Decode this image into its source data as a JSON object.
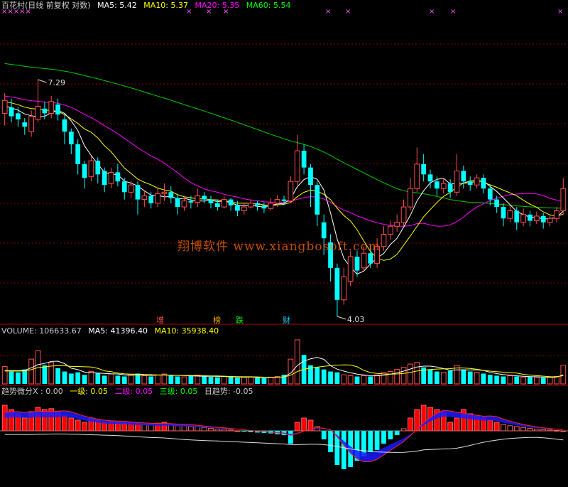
{
  "colors": {
    "up": "#ff5050",
    "down": "#00ffff",
    "ma5": "#ffffff",
    "ma10": "#ffff00",
    "ma20": "#ff00ff",
    "ma60": "#00cc00",
    "grid": "#8a0000",
    "label": "#cccccc"
  },
  "price_header": {
    "name": "百花村(日线 前复权 对数)",
    "ma5_label": "MA5: 5.42",
    "ma10_label": "MA10: 5.37",
    "ma20_label": "MA20: 5.35",
    "ma60_label": "MA60: 5.54"
  },
  "volume_header": {
    "vol_label": "VOLUME: 106633.67",
    "ma5_label": "MA5: 41396.40",
    "ma10_label": "MA10: 35938.40"
  },
  "indicator_header": {
    "name_label": "趋势微分X : 0.00",
    "l1_label": "一级: 0.05",
    "l2_label": "二级: 0.05",
    "l3_label": "三级: 0.05",
    "trend_label": "日趋势: -0.05"
  },
  "watermark": "翔博软件 www.xiangbosoft.com",
  "top_markers": [
    "×××××",
    "×",
    "×",
    "×",
    "×",
    "×",
    "×",
    "×",
    "×"
  ],
  "signals": [
    {
      "text": "增",
      "color": "#ff5050"
    },
    {
      "text": "榜",
      "color": "#ffaa00"
    },
    {
      "text": "跌",
      "color": "#00ff00"
    },
    {
      "text": "财",
      "color": "#00ccff"
    }
  ],
  "annotations": {
    "high": "7.29",
    "low": "4.03"
  },
  "chart_data": {
    "type": "candlestick",
    "candles": [
      [
        6.7,
        6.92,
        6.5,
        7.05
      ],
      [
        6.8,
        6.65,
        6.55,
        6.95
      ],
      [
        6.7,
        6.6,
        6.48,
        6.8
      ],
      [
        6.55,
        6.48,
        6.35,
        6.62
      ],
      [
        6.4,
        6.65,
        6.32,
        6.75
      ],
      [
        6.6,
        6.82,
        6.55,
        7.29
      ],
      [
        6.78,
        6.7,
        6.6,
        6.9
      ],
      [
        6.7,
        6.9,
        6.62,
        7.0
      ],
      [
        6.85,
        6.68,
        6.58,
        6.95
      ],
      [
        6.6,
        6.4,
        6.2,
        6.68
      ],
      [
        6.4,
        6.2,
        6.05,
        6.45
      ],
      [
        6.2,
        5.9,
        5.75,
        6.28
      ],
      [
        5.9,
        5.7,
        5.55,
        5.95
      ],
      [
        5.72,
        5.95,
        5.65,
        6.02
      ],
      [
        5.95,
        5.75,
        5.62,
        6.0
      ],
      [
        5.8,
        5.6,
        5.5,
        5.85
      ],
      [
        5.62,
        5.78,
        5.55,
        5.85
      ],
      [
        5.78,
        5.65,
        5.58,
        5.9
      ],
      [
        5.65,
        5.5,
        5.4,
        5.7
      ],
      [
        5.5,
        5.6,
        5.42,
        5.65
      ],
      [
        5.6,
        5.4,
        5.2,
        5.65
      ],
      [
        5.4,
        5.45,
        5.3,
        5.52
      ],
      [
        5.45,
        5.35,
        5.28,
        5.5
      ],
      [
        5.35,
        5.48,
        5.3,
        5.55
      ],
      [
        5.48,
        5.5,
        5.38,
        5.62
      ],
      [
        5.5,
        5.42,
        5.35,
        5.58
      ],
      [
        5.42,
        5.3,
        5.2,
        5.48
      ],
      [
        5.3,
        5.38,
        5.25,
        5.45
      ],
      [
        5.38,
        5.36,
        5.28,
        5.45
      ],
      [
        5.36,
        5.45,
        5.3,
        5.55
      ],
      [
        5.45,
        5.4,
        5.35,
        5.5
      ],
      [
        5.4,
        5.35,
        5.28,
        5.45
      ],
      [
        5.35,
        5.3,
        5.25,
        5.4
      ],
      [
        5.3,
        5.4,
        5.28,
        5.44
      ],
      [
        5.4,
        5.32,
        5.25,
        5.42
      ],
      [
        5.32,
        5.25,
        5.18,
        5.38
      ],
      [
        5.25,
        5.3,
        5.2,
        5.35
      ],
      [
        5.3,
        5.35,
        5.28,
        5.4
      ],
      [
        5.35,
        5.32,
        5.25,
        5.38
      ],
      [
        5.32,
        5.28,
        5.22,
        5.36
      ],
      [
        5.28,
        5.35,
        5.25,
        5.42
      ],
      [
        5.35,
        5.4,
        5.3,
        5.46
      ],
      [
        5.4,
        5.38,
        5.32,
        5.45
      ],
      [
        5.38,
        5.65,
        5.35,
        5.72
      ],
      [
        5.65,
        6.1,
        5.6,
        6.35
      ],
      [
        6.1,
        5.85,
        5.75,
        6.2
      ],
      [
        5.85,
        5.6,
        5.3,
        5.9
      ],
      [
        5.6,
        5.2,
        5.05,
        5.65
      ],
      [
        5.1,
        4.9,
        4.7,
        5.2
      ],
      [
        4.85,
        4.55,
        4.4,
        4.95
      ],
      [
        4.55,
        4.2,
        4.03,
        4.6
      ],
      [
        4.2,
        4.45,
        4.15,
        4.55
      ],
      [
        4.4,
        4.68,
        4.35,
        4.75
      ],
      [
        4.68,
        4.52,
        4.45,
        4.75
      ],
      [
        4.55,
        4.72,
        4.5,
        4.8
      ],
      [
        4.72,
        4.6,
        4.55,
        4.82
      ],
      [
        4.6,
        4.8,
        4.55,
        4.9
      ],
      [
        4.8,
        4.95,
        4.75,
        5.05
      ],
      [
        4.95,
        5.05,
        4.88,
        5.12
      ],
      [
        5.05,
        5.1,
        4.98,
        5.2
      ],
      [
        5.1,
        5.3,
        5.05,
        5.4
      ],
      [
        5.3,
        5.55,
        5.25,
        5.7
      ],
      [
        5.55,
        5.9,
        5.5,
        6.15
      ],
      [
        5.9,
        5.75,
        5.65,
        6.05
      ],
      [
        5.75,
        5.65,
        5.55,
        5.82
      ],
      [
        5.65,
        5.55,
        5.45,
        5.72
      ],
      [
        5.55,
        5.62,
        5.48,
        5.7
      ],
      [
        5.62,
        5.5,
        5.42,
        5.68
      ],
      [
        5.5,
        5.8,
        5.45,
        6.05
      ],
      [
        5.8,
        5.65,
        5.55,
        5.88
      ],
      [
        5.65,
        5.6,
        5.52,
        5.72
      ],
      [
        5.6,
        5.7,
        5.55,
        5.75
      ],
      [
        5.7,
        5.55,
        5.48,
        5.75
      ],
      [
        5.55,
        5.4,
        5.32,
        5.6
      ],
      [
        5.4,
        5.3,
        5.22,
        5.45
      ],
      [
        5.3,
        5.15,
        5.05,
        5.35
      ],
      [
        5.15,
        5.25,
        5.1,
        5.32
      ],
      [
        5.25,
        5.1,
        5.0,
        5.3
      ],
      [
        5.1,
        5.2,
        5.05,
        5.28
      ],
      [
        5.2,
        5.12,
        5.05,
        5.25
      ],
      [
        5.12,
        5.18,
        5.08,
        5.24
      ],
      [
        5.18,
        5.1,
        5.02,
        5.22
      ],
      [
        5.1,
        5.15,
        5.05,
        5.2
      ],
      [
        5.15,
        5.25,
        5.1,
        5.3
      ],
      [
        5.25,
        5.55,
        5.2,
        5.7
      ]
    ],
    "volume": [
      42000,
      30000,
      28000,
      35000,
      60000,
      80000,
      45000,
      52000,
      38000,
      30000,
      25000,
      28000,
      22000,
      30000,
      26000,
      20000,
      24000,
      20000,
      18000,
      22000,
      25000,
      20000,
      18000,
      22000,
      24000,
      20000,
      18000,
      17000,
      19000,
      21000,
      18000,
      17000,
      16000,
      18000,
      17000,
      15000,
      16000,
      17000,
      15000,
      14000,
      16000,
      18000,
      22000,
      60000,
      106633,
      70000,
      45000,
      40000,
      35000,
      30000,
      28000,
      22000,
      20000,
      18000,
      20000,
      18000,
      22000,
      28000,
      30000,
      35000,
      40000,
      48000,
      52000,
      40000,
      35000,
      30000,
      28000,
      32000,
      45000,
      35000,
      30000,
      28000,
      25000,
      22000,
      20000,
      18000,
      20000,
      18000,
      16000,
      17000,
      16000,
      15000,
      16000,
      18000,
      45000
    ],
    "indicator": [
      0.6,
      0.5,
      0.4,
      0.3,
      0.45,
      0.55,
      0.5,
      0.52,
      0.45,
      0.35,
      0.3,
      0.25,
      0.2,
      0.3,
      0.25,
      0.2,
      0.22,
      0.2,
      0.18,
      0.2,
      0.18,
      0.15,
      0.15,
      0.18,
      0.2,
      0.15,
      0.12,
      0.12,
      0.1,
      0.1,
      0.08,
      0.06,
      0.04,
      0.04,
      0.02,
      0.0,
      -0.02,
      -0.03,
      -0.04,
      -0.05,
      -0.06,
      -0.08,
      -0.1,
      -0.3,
      0.2,
      0.3,
      0.25,
      0.1,
      -0.2,
      -0.5,
      -0.8,
      -0.9,
      -0.85,
      -0.7,
      -0.6,
      -0.5,
      -0.45,
      -0.3,
      -0.2,
      -0.1,
      0.05,
      0.3,
      0.5,
      0.6,
      0.55,
      0.5,
      0.45,
      0.2,
      0.3,
      0.5,
      0.4,
      0.35,
      0.3,
      0.25,
      0.2,
      0.15,
      0.12,
      0.1,
      0.08,
      0.06,
      0.04,
      0.03,
      0.02,
      0.01,
      0.0
    ],
    "ylim_log": [
      4.03,
      7.29
    ]
  }
}
